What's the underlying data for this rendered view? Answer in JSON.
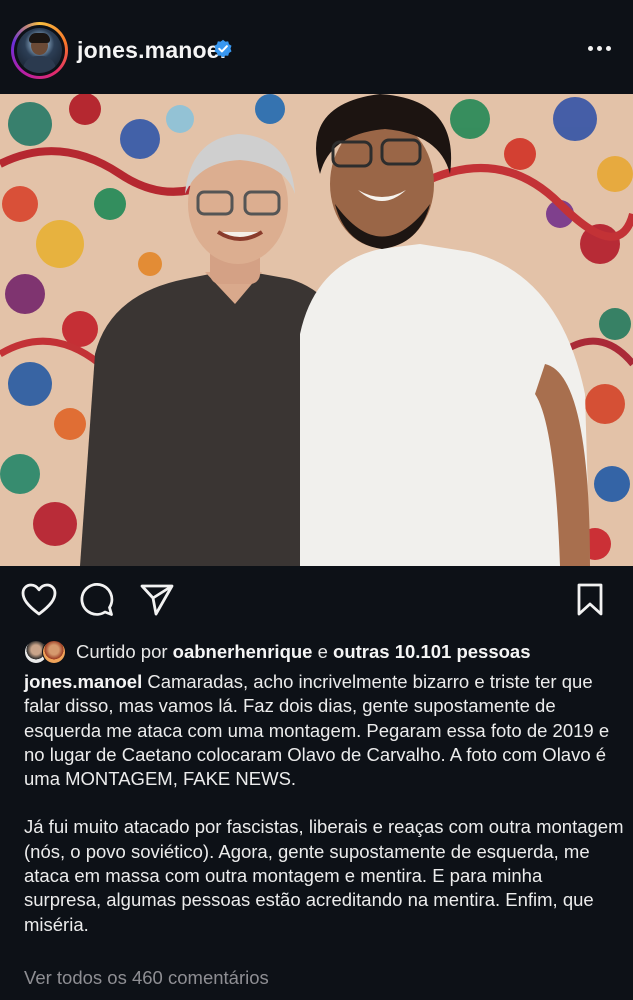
{
  "post": {
    "username": "jones.manoel",
    "verified": true,
    "more_icon": "more-horizontal-icon",
    "image_alt": "Photo of two men smiling in front of a colorful floral painting"
  },
  "actions": {
    "like_icon": "heart-icon",
    "comment_icon": "comment-icon",
    "share_icon": "send-icon",
    "save_icon": "bookmark-icon"
  },
  "likes": {
    "prefix": "Curtido por",
    "user": "oabnerhenrique",
    "conjunction": "e",
    "others": "outras 10.101 pessoas"
  },
  "caption": {
    "username": "jones.manoel",
    "paragraph1": "Camaradas, acho incrivelmente bizarro e triste ter que falar disso, mas vamos lá. Faz dois dias, gente supostamente de esquerda me ataca com uma montagem. Pegaram essa foto de 2019 e no lugar de Caetano colocaram Olavo de Carvalho. A foto com Olavo é uma MONTAGEM, FAKE NEWS.",
    "paragraph2": "Já fui muito atacado por fascistas, liberais e reaças com outra montagem (nós, o povo soviético). Agora, gente supostamente de esquerda, me ataca em massa com outra montagem e mentira. E para minha surpresa, algumas pessoas estão acreditando na mentira. Enfim, que miséria."
  },
  "comments": {
    "view_all": "Ver todos os 460 comentários"
  },
  "colors": {
    "background": "#0d1117",
    "verified_blue": "#3897f0",
    "muted_text": "#8e8e93"
  }
}
